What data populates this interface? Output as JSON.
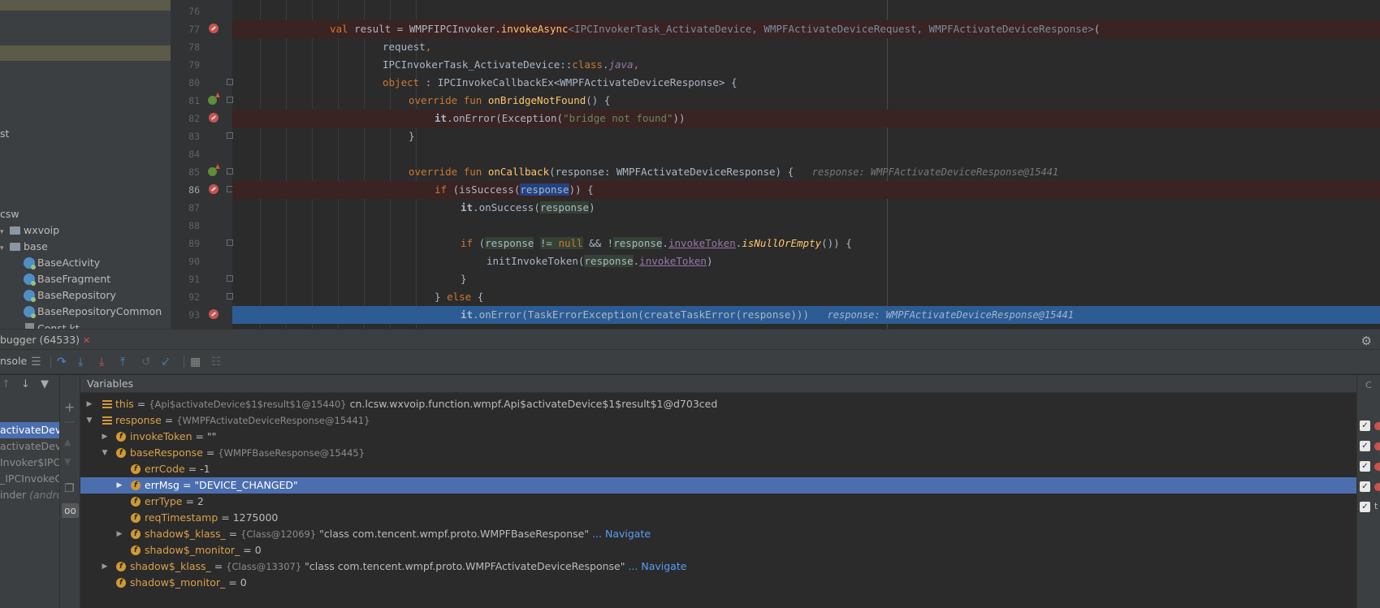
{
  "project_tree": {
    "items": [
      {
        "label": "st"
      },
      {
        "label": "csw"
      },
      {
        "label": "wxvoip"
      },
      {
        "label": "base"
      },
      {
        "label": "BaseActivity"
      },
      {
        "label": "BaseFragment"
      },
      {
        "label": "BaseRepository"
      },
      {
        "label": "BaseRepositoryCommon"
      },
      {
        "label": "Const.kt"
      }
    ]
  },
  "editor": {
    "line_numbers": [
      "76",
      "77",
      "78",
      "79",
      "80",
      "81",
      "82",
      "83",
      "84",
      "85",
      "86",
      "87",
      "88",
      "89",
      "90",
      "91",
      "92",
      "93"
    ],
    "inlays": {
      "line85": "response: WMPFActivateDeviceResponse@15441",
      "line93": "response: WMPFActivateDeviceResponse@15441"
    }
  },
  "debugger": {
    "tab_title": "bugger (64533)",
    "console_label": "nsole",
    "variables_title": "Variables",
    "frames": [
      {
        "label": "activateDevic"
      },
      {
        "label": "activateDevic"
      },
      {
        "label": "Invoker$IPC"
      },
      {
        "label": "_IPCInvokeC"
      },
      {
        "label": "inder ",
        "suffix": "(andro"
      }
    ],
    "variables": [
      {
        "name": "this",
        "type": "{Api$activateDevice$1$result$1@15440}",
        "value": "cn.lcsw.wxvoip.function.wmpf.Api$activateDevice$1$result$1@d703ced"
      },
      {
        "name": "response",
        "type": "{WMPFActivateDeviceResponse@15441}",
        "value": ""
      },
      {
        "name": "invokeToken",
        "type": "",
        "value": "\"\""
      },
      {
        "name": "baseResponse",
        "type": "{WMPFBaseResponse@15445}",
        "value": ""
      },
      {
        "name": "errCode",
        "type": "",
        "value": "-1"
      },
      {
        "name": "errMsg",
        "type": "",
        "value": "\"DEVICE_CHANGED\""
      },
      {
        "name": "errType",
        "type": "",
        "value": "2"
      },
      {
        "name": "reqTimestamp",
        "type": "",
        "value": "1275000"
      },
      {
        "name": "shadow$_klass_",
        "type": "{Class@12069}",
        "value": "\"class com.tencent.wmpf.proto.WMPFBaseResponse\"",
        "link": "... Navigate"
      },
      {
        "name": "shadow$_monitor_",
        "type": "",
        "value": "0"
      },
      {
        "name": "shadow$_klass_",
        "type": "{Class@13307}",
        "value": "\"class com.tencent.wmpf.proto.WMPFActivateDeviceResponse\"",
        "link": "... Navigate"
      },
      {
        "name": "shadow$_monitor_",
        "type": "",
        "value": "0"
      }
    ],
    "watch_header": "C",
    "watch_last": "t"
  }
}
